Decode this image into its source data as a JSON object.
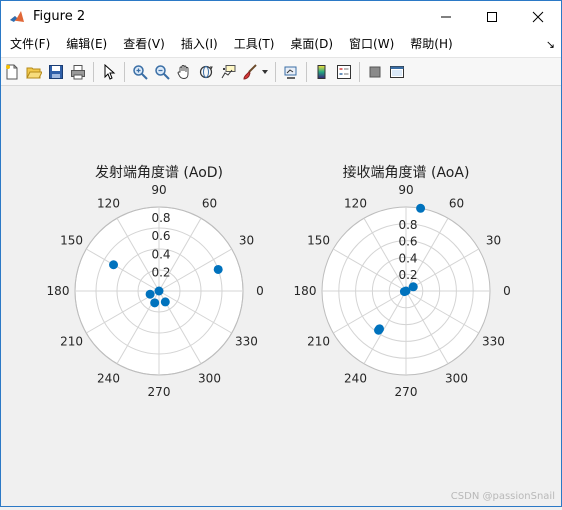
{
  "window": {
    "title": "Figure 2"
  },
  "menu": {
    "items": [
      "文件(F)",
      "编辑(E)",
      "查看(V)",
      "插入(I)",
      "工具(T)",
      "桌面(D)",
      "窗口(W)",
      "帮助(H)"
    ],
    "overflow": "↘"
  },
  "toolbar": {
    "buttons": [
      "new-figure-icon",
      "open-file-icon",
      "save-icon",
      "print-icon",
      "pointer-icon",
      "zoom-in-icon",
      "zoom-out-icon",
      "pan-hand-icon",
      "rotate-3d-icon",
      "data-cursor-icon",
      "brush-icon",
      "link-plot-icon",
      "colorbar-icon",
      "legend-icon",
      "hide-plot-tools-icon",
      "show-plot-tools-icon"
    ]
  },
  "colors": {
    "marker": "#0072bd",
    "grid": "#d4d4d4",
    "accent": "#2b79c6"
  },
  "charts": {
    "aod": {
      "title": "发射端角度谱 (AoD)",
      "angle_labels": [
        "0",
        "30",
        "60",
        "90",
        "120",
        "150",
        "180",
        "210",
        "240",
        "270",
        "300",
        "330"
      ],
      "r_labels": [
        "0.2",
        "0.4",
        "0.6",
        "0.8"
      ]
    },
    "aoa": {
      "title": "接收端角度谱 (AoA)",
      "angle_labels": [
        "0",
        "30",
        "60",
        "90",
        "120",
        "150",
        "180",
        "210",
        "240",
        "270",
        "300",
        "330"
      ],
      "r_labels": [
        "0.2",
        "0.4",
        "0.6",
        "0.8"
      ]
    }
  },
  "chart_data": [
    {
      "type": "scatter",
      "coordinate_system": "polar",
      "title": "发射端角度谱 (AoD)",
      "theta_deg": [
        150,
        20,
        200,
        300,
        250,
        180
      ],
      "r": [
        0.5,
        0.6,
        0.09,
        0.12,
        0.12,
        0.0
      ],
      "rlim": [
        0,
        0.8
      ],
      "rticks": [
        0.2,
        0.4,
        0.6,
        0.8
      ],
      "thetaticks_deg": [
        0,
        30,
        60,
        90,
        120,
        150,
        180,
        210,
        240,
        270,
        300,
        330
      ],
      "grid": true
    },
    {
      "type": "scatter",
      "coordinate_system": "polar",
      "title": "接收端角度谱 (AoA)",
      "theta_deg": [
        80,
        30,
        235,
        235,
        230,
        200
      ],
      "r": [
        1.0,
        0.1,
        0.57,
        0.55,
        0.0,
        0.02
      ],
      "rlim": [
        0,
        1.0
      ],
      "rticks": [
        0.2,
        0.4,
        0.6,
        0.8
      ],
      "thetaticks_deg": [
        0,
        30,
        60,
        90,
        120,
        150,
        180,
        210,
        240,
        270,
        300,
        330
      ],
      "grid": true
    }
  ],
  "watermark": "CSDN @passionSnail"
}
